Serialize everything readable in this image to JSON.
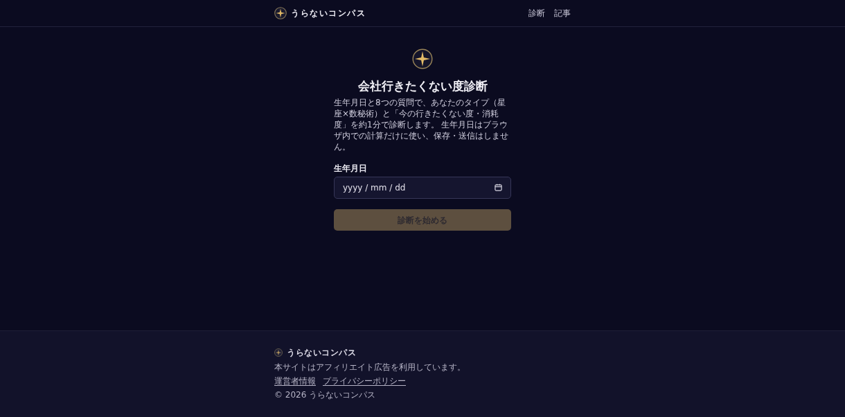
{
  "header": {
    "logo": {
      "text": "うらないコンパス"
    },
    "nav": [
      {
        "label": "診断"
      },
      {
        "label": "記事"
      }
    ]
  },
  "main": {
    "title": "会社行きたくない度診断",
    "description": "生年月日と8つの質問で、あなたのタイプ（星座×数秘術）と「今の行きたくない度・消耗度」を約1分で診断します。 生年月日はブラウザ内での計算だけに使い、保存・送信はしません。",
    "birthdate": {
      "label": "生年月日",
      "placeholder": "yyyy / mm / dd"
    },
    "start_button": {
      "label": "診断を始める",
      "disabled": true
    }
  },
  "footer": {
    "logo": {
      "text": "うらないコンパス"
    },
    "notice": "本サイトはアフィリエイト広告を利用しています。",
    "links": [
      {
        "label": "運営者情報"
      },
      {
        "label": "プライバシーポリシー"
      }
    ],
    "copyright": "© 2026 うらないコンパス"
  }
}
